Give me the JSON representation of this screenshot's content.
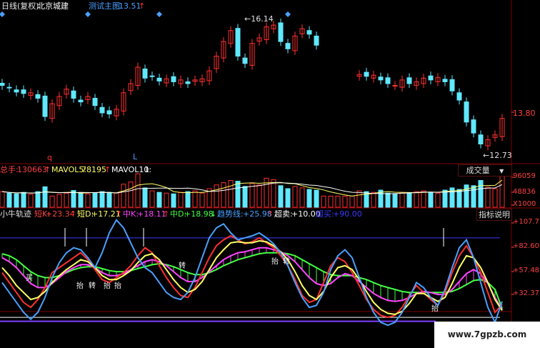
{
  "header": {
    "period": "日线(复权)",
    "stock_name": "北京城建",
    "test_label": "测试主图:",
    "test_value": "13.51",
    "test_arrow": "↑"
  },
  "price_panel": {
    "y_label": "13.80",
    "high_label": "←16.14",
    "low_label": "←12.73",
    "markers": [
      "q",
      "L"
    ]
  },
  "volume_panel": {
    "legend": [
      {
        "label": "总手:",
        "value": "130663",
        "arrow": "↑",
        "color": "#ff4040"
      },
      {
        "label": "MAVOL5:",
        "value": "78195",
        "arrow": "↑",
        "color": "#ffff66"
      },
      {
        "label": "MAVOL10:",
        "value": "1",
        "arrow": "",
        "color": "#ffffff"
      }
    ],
    "dropdown_label": "成交量",
    "y_labels": [
      "96059",
      "48836",
      "X1000"
    ]
  },
  "indicator_panel": {
    "legend": [
      {
        "label": "小牛轨迹",
        "value": "",
        "color": "#e0e0e0"
      },
      {
        "label": "短K:",
        "value": "+23.34",
        "arrow": "↑",
        "color": "#ff4040"
      },
      {
        "label": "短D:",
        "value": "+17.21",
        "arrow": "↑",
        "color": "#ffff66"
      },
      {
        "label": "中K:",
        "value": "+18.11",
        "arrow": "↑",
        "color": "#ff44ff"
      },
      {
        "label": "中D:",
        "value": "+18.98",
        "arrow": "↓",
        "color": "#44ff44"
      },
      {
        "label": "趋势线:",
        "value": "+25.98",
        "arrow": "↑",
        "color": "#4aa0ff"
      },
      {
        "label": "超卖:",
        "value": "+10.00",
        "arrow": "",
        "color": "#ffffff"
      },
      {
        "label": "超买:",
        "value": "+90.00",
        "arrow": "",
        "color": "#3a3aff"
      }
    ],
    "button_label": "指标说明",
    "y_labels": [
      "+107.7",
      "+82.60",
      "+57.48",
      "+32.37"
    ],
    "annotations": [
      "买",
      "抬",
      "转",
      "抬",
      "抬",
      "转",
      "抬",
      "转",
      "抬"
    ]
  },
  "watermark": "www.7gpzb.com",
  "colors": {
    "up": "#ff3030",
    "down": "#60e8ff",
    "grid": "#800000",
    "bg": "#000000"
  },
  "chart_data": [
    {
      "type": "candlestick",
      "title": "北京城建 日线(复权)",
      "ylim": [
        12.4,
        16.5
      ],
      "high": 16.14,
      "low": 12.73,
      "close": [
        14.4,
        14.33,
        14.22,
        14.18,
        14.2,
        14.05,
        13.55,
        13.9,
        14.1,
        14.3,
        14.05,
        13.95,
        14.1,
        13.85,
        13.65,
        13.62,
        13.75,
        14.2,
        14.45,
        14.9,
        14.6,
        14.65,
        14.52,
        14.58,
        14.5,
        14.55,
        14.45,
        14.55,
        14.58,
        14.8,
        15.2,
        15.6,
        15.9,
        15.2,
        15.0,
        15.55,
        15.7,
        16.0,
        16.05,
        15.6,
        15.4,
        15.75,
        15.95,
        15.8,
        15.5,
        null,
        null,
        null,
        null,
        null,
        14.7,
        14.65,
        14.68,
        14.55,
        14.45,
        14.4,
        14.55,
        14.45,
        14.5,
        14.6,
        14.55,
        14.62,
        14.5,
        14.25,
        14.0,
        13.4,
        13.1,
        12.8,
        12.92,
        13.05,
        13.5
      ]
    },
    {
      "type": "bar",
      "title": "成交量",
      "ylim": [
        0,
        96059
      ],
      "values": [
        42000,
        38000,
        36000,
        40000,
        35000,
        42000,
        55000,
        30000,
        35000,
        38000,
        45000,
        40000,
        36000,
        38000,
        42000,
        40000,
        38000,
        62000,
        68000,
        90000,
        52000,
        44000,
        40000,
        38000,
        36000,
        40000,
        42000,
        44000,
        38000,
        50000,
        60000,
        66000,
        72000,
        70000,
        56000,
        64000,
        60000,
        78000,
        74000,
        58000,
        50000,
        56000,
        52000,
        48000,
        46000,
        30000,
        30000,
        30000,
        30000,
        30000,
        44000,
        42000,
        40000,
        46000,
        38000,
        36000,
        40000,
        38000,
        42000,
        44000,
        40000,
        38000,
        46000,
        52000,
        48000,
        60000,
        58000,
        72000,
        54000,
        50000,
        130663
      ]
    },
    {
      "type": "line",
      "title": "小牛轨迹",
      "ylim": [
        0,
        110
      ],
      "series": [
        {
          "name": "短K",
          "values": [
            55,
            45,
            35,
            25,
            20,
            28,
            40,
            55,
            60,
            65,
            70,
            75,
            68,
            58,
            48,
            45,
            50,
            55,
            62,
            72,
            80,
            75,
            62,
            50,
            40,
            32,
            30,
            40,
            55,
            70,
            82,
            88,
            92,
            88,
            84,
            86,
            90,
            85,
            80,
            72,
            62,
            48,
            32,
            25,
            28,
            45,
            62,
            70,
            66,
            55,
            42,
            28,
            18,
            12,
            10,
            12,
            20,
            32,
            42,
            35,
            28,
            22,
            35,
            55,
            72,
            82,
            70,
            55,
            35,
            15,
            23
          ]
        },
        {
          "name": "短D",
          "values": [
            60,
            52,
            42,
            35,
            28,
            30,
            36,
            45,
            52,
            58,
            63,
            68,
            66,
            60,
            52,
            48,
            48,
            52,
            57,
            65,
            72,
            74,
            68,
            58,
            48,
            40,
            35,
            38,
            46,
            58,
            70,
            78,
            85,
            86,
            85,
            85,
            87,
            86,
            82,
            76,
            68,
            56,
            42,
            32,
            28,
            36,
            50,
            60,
            62,
            58,
            48,
            36,
            25,
            18,
            14,
            13,
            16,
            24,
            34,
            34,
            30,
            26,
            30,
            44,
            60,
            72,
            70,
            60,
            45,
            28,
            17
          ]
        },
        {
          "name": "中K",
          "values": [
            70,
            66,
            60,
            52,
            44,
            40,
            40,
            44,
            50,
            56,
            60,
            63,
            63,
            60,
            55,
            52,
            52,
            54,
            58,
            62,
            66,
            68,
            66,
            62,
            56,
            50,
            46,
            46,
            50,
            56,
            62,
            68,
            72,
            75,
            76,
            78,
            80,
            80,
            78,
            76,
            72,
            66,
            58,
            50,
            44,
            42,
            44,
            50,
            54,
            52,
            46,
            40,
            34,
            30,
            27,
            26,
            27,
            30,
            34,
            36,
            35,
            33,
            33,
            38,
            46,
            54,
            58,
            54,
            44,
            30,
            18
          ]
        },
        {
          "name": "中D",
          "values": [
            74,
            72,
            68,
            62,
            56,
            52,
            50,
            50,
            52,
            55,
            58,
            60,
            61,
            61,
            59,
            57,
            56,
            56,
            57,
            59,
            61,
            63,
            64,
            63,
            61,
            58,
            55,
            53,
            53,
            55,
            58,
            62,
            65,
            68,
            70,
            72,
            74,
            75,
            75,
            75,
            74,
            72,
            68,
            64,
            60,
            56,
            53,
            52,
            52,
            52,
            50,
            48,
            45,
            42,
            40,
            38,
            36,
            35,
            35,
            35,
            35,
            35,
            35,
            36,
            39,
            43,
            47,
            48,
            45,
            38,
            19
          ]
        },
        {
          "name": "趋势线",
          "values": [
            45,
            35,
            25,
            15,
            8,
            15,
            30,
            50,
            65,
            75,
            80,
            78,
            70,
            60,
            75,
            95,
            108,
            100,
            85,
            70,
            60,
            55,
            45,
            35,
            30,
            28,
            35,
            50,
            70,
            90,
            100,
            104,
            95,
            88,
            90,
            92,
            95,
            90,
            84,
            75,
            62,
            45,
            30,
            20,
            22,
            35,
            58,
            72,
            78,
            70,
            50,
            30,
            15,
            5,
            2,
            5,
            15,
            30,
            45,
            40,
            30,
            22,
            38,
            60,
            80,
            88,
            70,
            45,
            20,
            5,
            26
          ]
        },
        {
          "name": "超卖",
          "values": [
            10
          ]
        },
        {
          "name": "超买",
          "values": [
            90
          ]
        }
      ]
    }
  ]
}
